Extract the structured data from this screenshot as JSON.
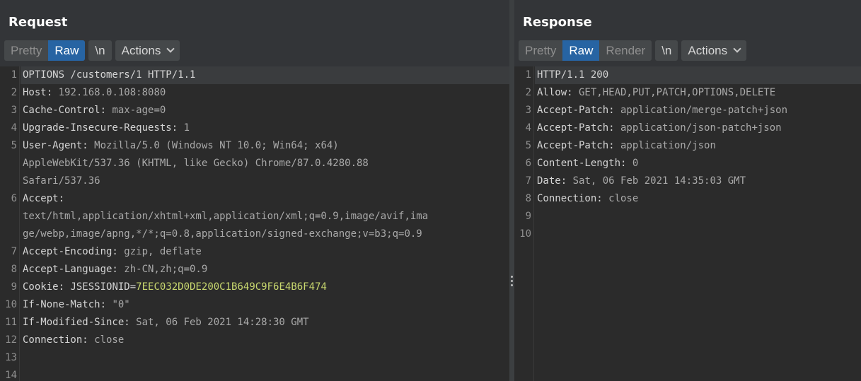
{
  "request": {
    "title": "Request",
    "tabs": {
      "pretty": "Pretty",
      "raw": "Raw",
      "newline": "\\n",
      "actions": "Actions"
    },
    "line_numbers": [
      "1",
      "2",
      "3",
      "4",
      "5",
      "6",
      "7",
      "8",
      "9",
      "10",
      "11",
      "12",
      "13",
      "14"
    ],
    "lines": {
      "l1": "OPTIONS /customers/1 HTTP/1.1",
      "l2k": "Host:",
      "l2v": " 192.168.0.108:8080",
      "l3k": "Cache-Control:",
      "l3v": " max-age=0",
      "l4k": "Upgrade-Insecure-Requests:",
      "l4v": " 1",
      "l5k": "User-Agent:",
      "l5v": " Mozilla/5.0 (Windows NT 10.0; Win64; x64)",
      "l5b": "AppleWebKit/537.36 (KHTML, like Gecko) Chrome/87.0.4280.88",
      "l5c": "Safari/537.36",
      "l6k": "Accept:",
      "l6b": "text/html,application/xhtml+xml,application/xml;q=0.9,image/avif,ima",
      "l6c": "ge/webp,image/apng,*/*;q=0.8,application/signed-exchange;v=b3;q=0.9",
      "l7k": "Accept-Encoding:",
      "l7v": " gzip, deflate",
      "l8k": "Accept-Language:",
      "l8v": " zh-CN,zh;q=0.9",
      "l9k": "Cookie:",
      "l9n": " JSESSIONID=",
      "l9v": "7EEC032D0DE200C1B649C9F6E4B6F474",
      "l10k": "If-None-Match:",
      "l10v": " \"0\"",
      "l11k": "If-Modified-Since:",
      "l11v": " Sat, 06 Feb 2021 14:28:30 GMT",
      "l12k": "Connection:",
      "l12v": " close"
    }
  },
  "response": {
    "title": "Response",
    "tabs": {
      "pretty": "Pretty",
      "raw": "Raw",
      "render": "Render",
      "newline": "\\n",
      "actions": "Actions"
    },
    "line_numbers": [
      "1",
      "2",
      "3",
      "4",
      "5",
      "6",
      "7",
      "8",
      "9",
      "10"
    ],
    "lines": {
      "l1": "HTTP/1.1 200",
      "l2k": "Allow:",
      "l2v": " GET,HEAD,PUT,PATCH,OPTIONS,DELETE",
      "l3k": "Accept-Patch:",
      "l3v": " application/merge-patch+json",
      "l4k": "Accept-Patch:",
      "l4v": " application/json-patch+json",
      "l5k": "Accept-Patch:",
      "l5v": " application/json",
      "l6k": "Content-Length:",
      "l6v": " 0",
      "l7k": "Date:",
      "l7v": " Sat, 06 Feb 2021 14:35:03 GMT",
      "l8k": "Connection:",
      "l8v": " close"
    }
  },
  "colors": {
    "accent": "#2764a3",
    "cookie_value": "#c9d86f",
    "background": "#2b2b2b"
  }
}
